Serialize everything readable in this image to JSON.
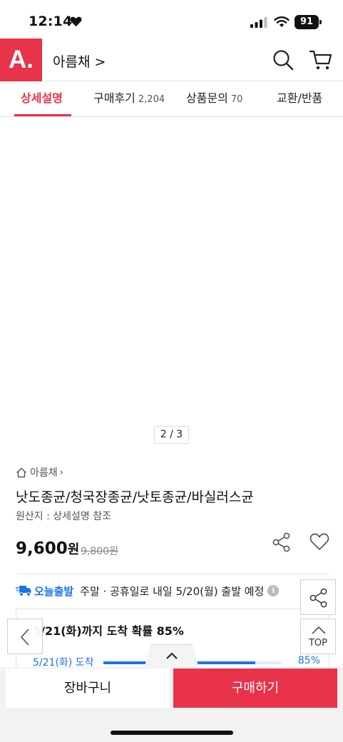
{
  "status_bar": {
    "time": "12:14",
    "battery": "91",
    "icons": [
      "heart-icon",
      "signal-icon",
      "wifi-icon",
      "battery-icon"
    ]
  },
  "header": {
    "logo": "A.",
    "store_name": "아름채 >",
    "icons": [
      "search-icon",
      "cart-icon"
    ],
    "brand_color": "#e8334a"
  },
  "tabs": [
    {
      "label": "상세설명",
      "count": "",
      "active": true
    },
    {
      "label": "구매후기",
      "count": "2,204",
      "active": false
    },
    {
      "label": "상품문의",
      "count": "70",
      "active": false
    },
    {
      "label": "교환/반품",
      "count": "",
      "active": false
    }
  ],
  "image": {
    "counter": "2 / 3"
  },
  "product": {
    "breadcrumb": "아름채",
    "title": "낫도종균/청국장종균/낫토종균/바실러스균",
    "origin": "원산지 : 상세설명 참조",
    "price": "9,600",
    "price_unit": "원",
    "original_price": "9,800원"
  },
  "shipping": {
    "badge": "오늘출발",
    "text": "주말 · 공휴일로 내일 5/20(월) 출발 예정",
    "info": "i",
    "arrival_title": "5/21(화)까지 도착 확률 85%",
    "collapse": "접기",
    "arrival_sub": "5/21(화) 도착",
    "arrival_pct": "85%",
    "arrival_fraction": 0.85,
    "accent_color": "#1a73e8"
  },
  "floating": {
    "top_label": "TOP"
  },
  "bottom": {
    "cart_label": "장바구니",
    "buy_label": "구매하기"
  }
}
